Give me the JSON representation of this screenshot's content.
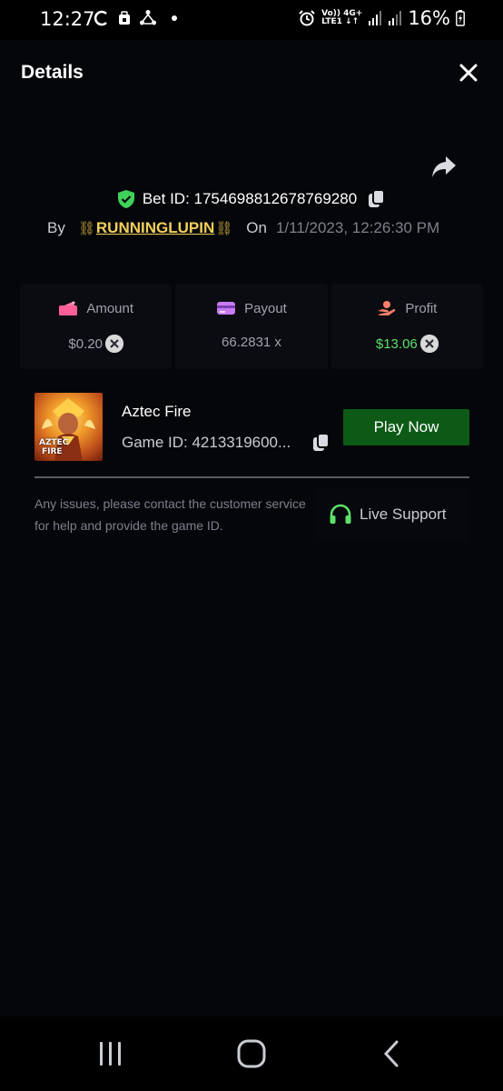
{
  "status_bar": {
    "time": "12:27",
    "battery": "16%",
    "network_top": "Vo)) 4G+",
    "network_bottom": "LTE1 ↓↑"
  },
  "header": {
    "title": "Details"
  },
  "bet": {
    "id_text": "Bet ID: 1754698812678769280",
    "by_label": "By",
    "username": "RUNNINGLUPIN",
    "on_label": "On",
    "date": "1/11/2023, 12:26:30 PM"
  },
  "stats": [
    {
      "label": "Amount",
      "value": "$0.20",
      "icon": "wallet-icon"
    },
    {
      "label": "Payout",
      "value": "66.2831 x",
      "icon": "card-icon"
    },
    {
      "label": "Profit",
      "value": "$13.06",
      "icon": "hand-coin-icon"
    }
  ],
  "game": {
    "name": "Aztec Fire",
    "id_text": "Game ID: 4213319600...",
    "thumb_text_1": "AZTEC",
    "thumb_text_2": "FIRE",
    "play_label": "Play Now"
  },
  "support": {
    "text": "Any issues, please contact the customer service for help and provide the game ID.",
    "button_label": "Live Support"
  },
  "colors": {
    "background": "#05060a",
    "accent_green": "#5ee06a",
    "play_button": "#0c5a16",
    "username": "#f2d05a",
    "verified": "#3fd15a"
  }
}
